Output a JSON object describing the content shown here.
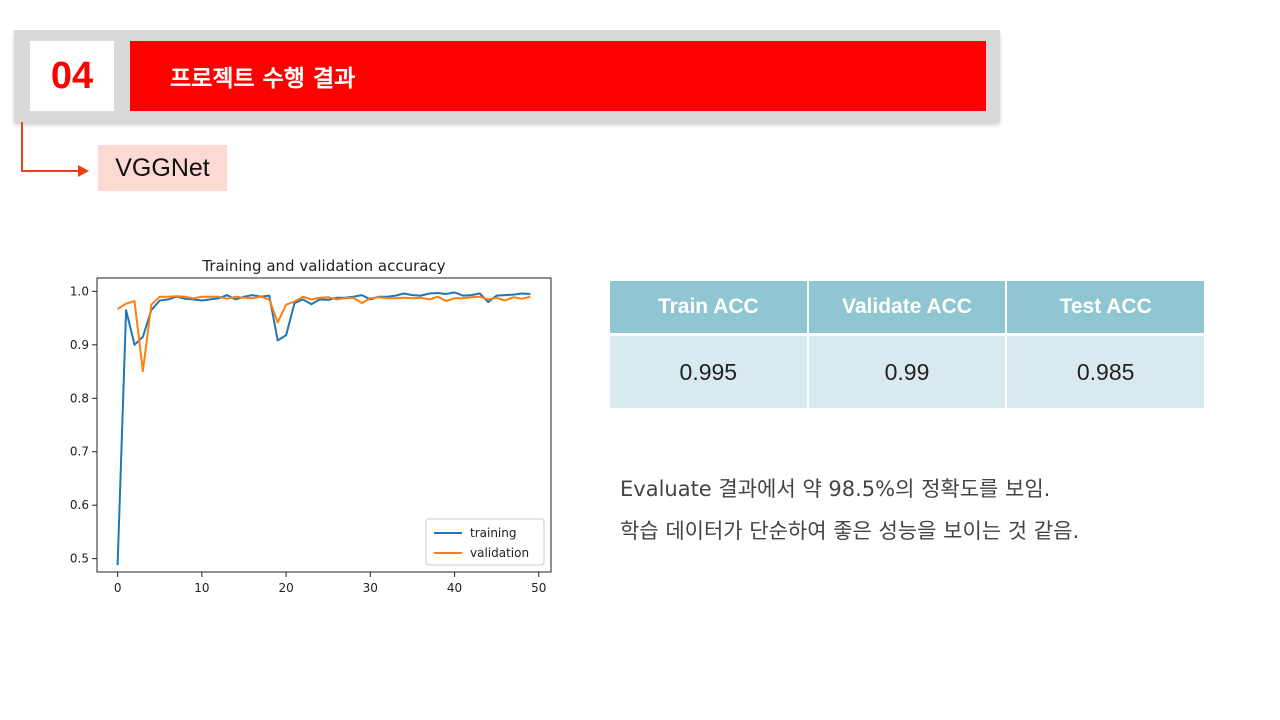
{
  "header": {
    "number": "04",
    "title": "프로젝트 수행 결과"
  },
  "sub_label": "VGGNet",
  "chart_data": {
    "type": "line",
    "title": "Training and validation accuracy",
    "xlabel": "",
    "ylabel": "",
    "xlim": [
      -2.45,
      51.45
    ],
    "ylim": [
      0.475,
      1.025
    ],
    "xticks": [
      0,
      10,
      20,
      30,
      40,
      50
    ],
    "yticks": [
      0.5,
      0.6,
      0.7,
      0.8,
      0.9,
      1.0
    ],
    "ytick_labels": [
      "0.5",
      "0.6",
      "0.7",
      "0.8",
      "0.9",
      "1.0"
    ],
    "legend_position": "lower-right",
    "grid": false,
    "x": [
      0,
      1,
      2,
      3,
      4,
      5,
      6,
      7,
      8,
      9,
      10,
      11,
      12,
      13,
      14,
      15,
      16,
      17,
      18,
      19,
      20,
      21,
      22,
      23,
      24,
      25,
      26,
      27,
      28,
      29,
      30,
      31,
      32,
      33,
      34,
      35,
      36,
      37,
      38,
      39,
      40,
      41,
      42,
      43,
      44,
      45,
      46,
      47,
      48,
      49
    ],
    "series": [
      {
        "name": "training",
        "color": "#1f77b4",
        "values": [
          0.488,
          0.965,
          0.9,
          0.915,
          0.965,
          0.983,
          0.985,
          0.99,
          0.986,
          0.985,
          0.983,
          0.985,
          0.987,
          0.993,
          0.985,
          0.99,
          0.993,
          0.99,
          0.992,
          0.908,
          0.918,
          0.978,
          0.985,
          0.976,
          0.985,
          0.984,
          0.988,
          0.988,
          0.99,
          0.993,
          0.985,
          0.99,
          0.99,
          0.992,
          0.996,
          0.993,
          0.992,
          0.996,
          0.997,
          0.995,
          0.998,
          0.992,
          0.993,
          0.996,
          0.98,
          0.992,
          0.993,
          0.994,
          0.996,
          0.995
        ]
      },
      {
        "name": "validation",
        "color": "#ff7f0e",
        "values": [
          0.967,
          0.977,
          0.982,
          0.851,
          0.975,
          0.99,
          0.99,
          0.991,
          0.99,
          0.987,
          0.99,
          0.99,
          0.99,
          0.986,
          0.99,
          0.988,
          0.987,
          0.99,
          0.985,
          0.942,
          0.975,
          0.981,
          0.99,
          0.985,
          0.988,
          0.989,
          0.985,
          0.987,
          0.988,
          0.978,
          0.987,
          0.989,
          0.987,
          0.987,
          0.988,
          0.987,
          0.988,
          0.985,
          0.99,
          0.982,
          0.987,
          0.987,
          0.989,
          0.99,
          0.985,
          0.988,
          0.983,
          0.989,
          0.986,
          0.99
        ]
      }
    ]
  },
  "table": {
    "headers": [
      "Train ACC",
      "Validate ACC",
      "Test ACC"
    ],
    "values": [
      "0.995",
      "0.99",
      "0.985"
    ]
  },
  "notes": [
    "Evaluate 결과에서 약 98.5%의 정확도를 보임.",
    "학습 데이터가 단순하여 좋은 성능을 보이는 것 같음."
  ]
}
